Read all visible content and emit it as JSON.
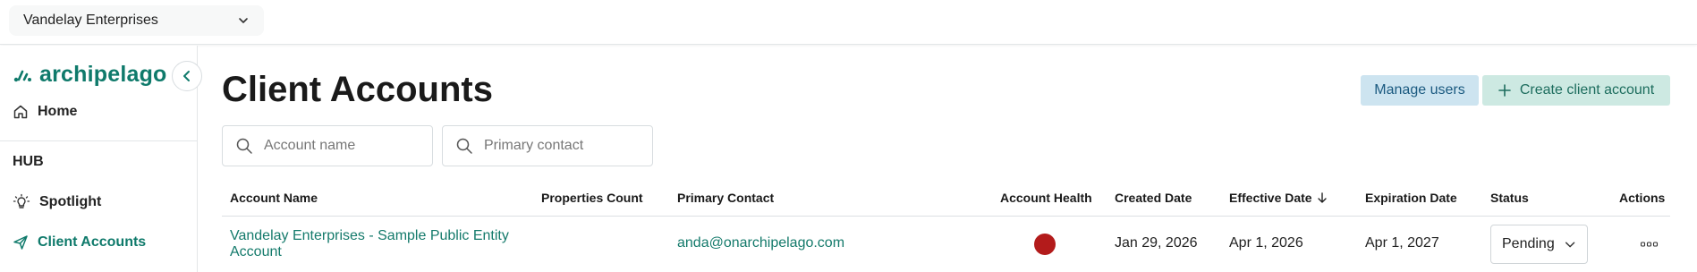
{
  "topbar": {
    "org_name": "Vandelay Enterprises"
  },
  "sidebar": {
    "logo_text": "archipelago",
    "home_label": "Home",
    "hub_label": "HUB",
    "items": [
      {
        "label": "Spotlight",
        "icon": "lightbulb-icon"
      },
      {
        "label": "Client Accounts",
        "icon": "send-icon",
        "active": true
      }
    ]
  },
  "page": {
    "title": "Client Accounts",
    "manage_users_label": "Manage users",
    "create_account_label": "Create client account"
  },
  "search": {
    "account_placeholder": "Account name",
    "contact_placeholder": "Primary contact"
  },
  "table": {
    "headers": {
      "account_name": "Account Name",
      "properties_count": "Properties Count",
      "primary_contact": "Primary Contact",
      "account_health": "Account Health",
      "created_date": "Created Date",
      "effective_date": "Effective Date",
      "expiration_date": "Expiration Date",
      "status": "Status",
      "actions": "Actions"
    },
    "sort": {
      "column": "effective_date",
      "direction": "descending"
    },
    "rows": [
      {
        "account_name": "Vandelay Enterprises - Sample Public Entity Account",
        "properties_count": "",
        "primary_contact": "anda@onarchipelago.com",
        "account_health_color": "#b31b1b",
        "created_date": "Jan 29, 2026",
        "effective_date": "Apr 1, 2026",
        "expiration_date": "Apr 1, 2027",
        "status": "Pending"
      }
    ]
  },
  "colors": {
    "brand": "#0f7a6b",
    "manage_button_bg": "#cde4f0",
    "create_button_bg": "#cde9e2",
    "health_red": "#b31b1b"
  }
}
